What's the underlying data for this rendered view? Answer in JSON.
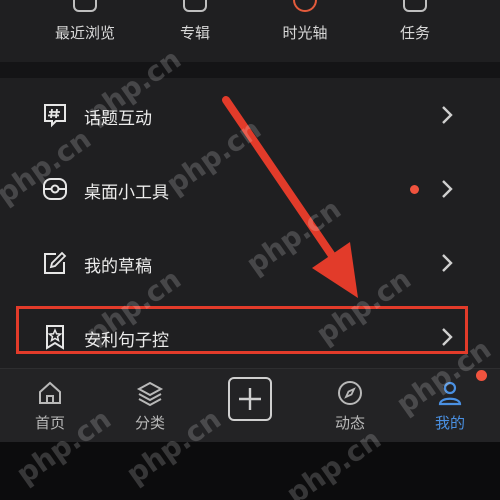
{
  "top_row": {
    "items": [
      {
        "label": "最近浏览",
        "icon": "history-icon"
      },
      {
        "label": "专辑",
        "icon": "album-icon"
      },
      {
        "label": "时光轴",
        "icon": "timeline-icon"
      },
      {
        "label": "任务",
        "icon": "task-icon"
      }
    ]
  },
  "menu": {
    "items": [
      {
        "label": "话题互动",
        "icon": "hashtag-icon",
        "badge": false
      },
      {
        "label": "桌面小工具",
        "icon": "widget-icon",
        "badge": true
      },
      {
        "label": "我的草稿",
        "icon": "draft-icon",
        "badge": false
      },
      {
        "label": "安利句子控",
        "icon": "star-bookmark-icon",
        "badge": false
      }
    ]
  },
  "tabbar": {
    "tabs": [
      {
        "label": "首页",
        "icon": "home-icon",
        "active": false
      },
      {
        "label": "分类",
        "icon": "layers-icon",
        "active": false
      },
      {
        "label": "",
        "icon": "plus-icon",
        "active": false
      },
      {
        "label": "动态",
        "icon": "compass-icon",
        "active": false
      },
      {
        "label": "我的",
        "icon": "profile-icon",
        "active": true
      }
    ]
  },
  "watermark": "php.cn",
  "colors": {
    "background": "#1c1c1e",
    "accent_blue": "#4a90e2",
    "highlight_red": "#e23b2a",
    "badge_red": "#f0533e"
  }
}
